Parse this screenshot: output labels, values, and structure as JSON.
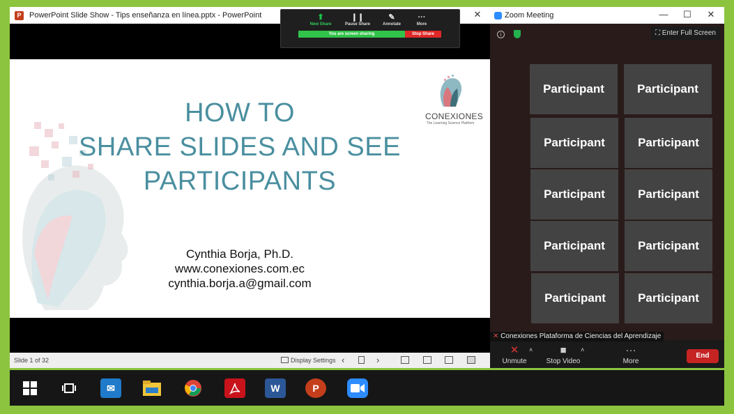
{
  "ppt": {
    "title": "PowerPoint Slide Show  -  Tips enseñanza en línea.pptx - PowerPoint",
    "close_glyph": "✕",
    "share_toolbar": {
      "items": [
        {
          "label": "New Share",
          "icon": "share-up-icon",
          "glyph": "⬆"
        },
        {
          "label": "Pause Share",
          "icon": "pause-icon",
          "glyph": "❙❙"
        },
        {
          "label": "Annotate",
          "icon": "pen-icon",
          "glyph": "✎"
        },
        {
          "label": "More",
          "icon": "more-icon",
          "glyph": "···"
        }
      ],
      "status": "You are screen sharing",
      "stop_label": "Stop Share",
      "accent": "#31c34a",
      "stop_color": "#e02828"
    },
    "slide": {
      "title_lines": [
        "HOW TO",
        "SHARE SLIDES AND SEE",
        "PARTICIPANTS"
      ],
      "author_lines": [
        "Cynthia Borja, Ph.D.",
        "www.conexiones.com.ec",
        "cynthia.borja.a@gmail.com"
      ],
      "logo_name": "CONEXIONES",
      "logo_tagline": "The Learning Science Platform",
      "title_color": "#4a8f9f"
    },
    "status": {
      "slide_counter": "Slide 1 of 32",
      "display_settings": "Display Settings"
    }
  },
  "zoom": {
    "title": "Zoom Meeting",
    "fullscreen_label": "Enter Full Screen",
    "participants": [
      "Participant",
      "Participant",
      "Participant",
      "Participant",
      "Participant",
      "Participant",
      "Participant",
      "Participant",
      "Participant",
      "Participant"
    ],
    "name_tag": "Conexiones Plataforma de Ciencias del Aprendizaje",
    "controls": {
      "unmute": "Unmute",
      "stop_video": "Stop Video",
      "more": "More",
      "end": "End"
    }
  },
  "taskbar": {
    "apps": [
      {
        "name": "start",
        "glyph": ""
      },
      {
        "name": "task-view",
        "glyph": ""
      },
      {
        "name": "mail",
        "glyph": "✉"
      },
      {
        "name": "file-explorer",
        "glyph": ""
      },
      {
        "name": "chrome",
        "glyph": ""
      },
      {
        "name": "acrobat",
        "glyph": ""
      },
      {
        "name": "word",
        "glyph": "W"
      },
      {
        "name": "powerpoint",
        "glyph": "P"
      },
      {
        "name": "zoom",
        "glyph": ""
      }
    ]
  }
}
